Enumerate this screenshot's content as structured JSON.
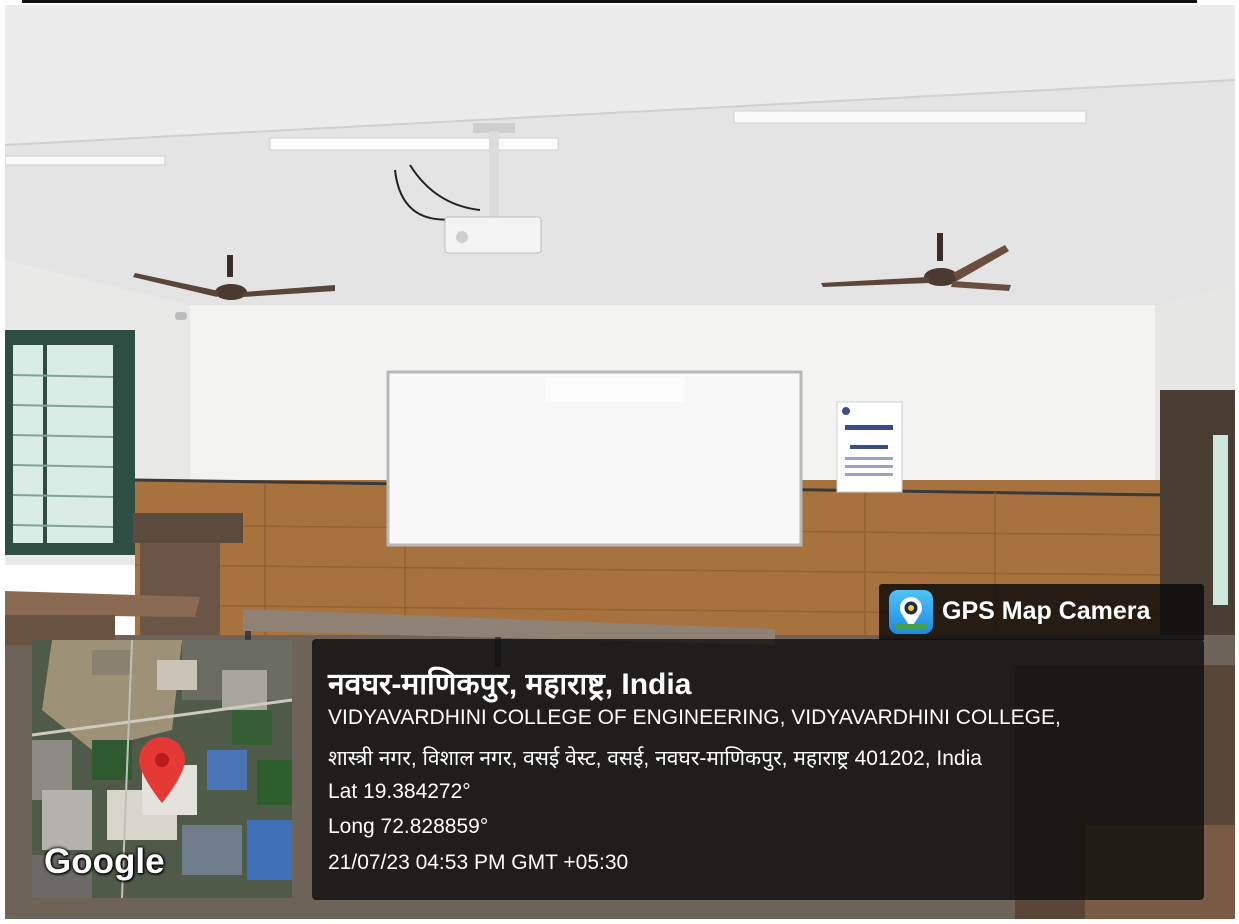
{
  "overlay": {
    "app_badge": {
      "label": "GPS Map Camera",
      "icon": "map-camera-icon",
      "color": "#1e88e5"
    },
    "location": {
      "title": "नवघर-माणिकपुर, महाराष्ट्र, India",
      "address_line_1": "VIDYAVARDHINI COLLEGE OF ENGINEERING, VIDYAVARDHINI COLLEGE,",
      "address_line_2": "शास्त्री नगर, विशाल नगर, वसई वेस्ट, वसई, नवघर-माणिकपुर, महाराष्ट्र 401202, India",
      "latitude": "Lat 19.384272°",
      "longitude": "Long 72.828859°",
      "datetime": "21/07/23 04:53 PM GMT +05:30"
    },
    "map": {
      "provider_label": "Google",
      "pin_icon": "map-pin-icon",
      "pin_color": "#e53935"
    }
  },
  "scene": {
    "subject": "classroom",
    "colors": {
      "ceiling": "#ebebeb",
      "wall": "#f2f2f1",
      "wood_panel": "#a9743f",
      "floor": "#6e6359"
    },
    "objects": [
      "projector",
      "ceiling-fan",
      "ceiling-fan",
      "whiteboard",
      "notice-poster",
      "window",
      "lectern",
      "door",
      "desk",
      "desk",
      "desk"
    ]
  }
}
